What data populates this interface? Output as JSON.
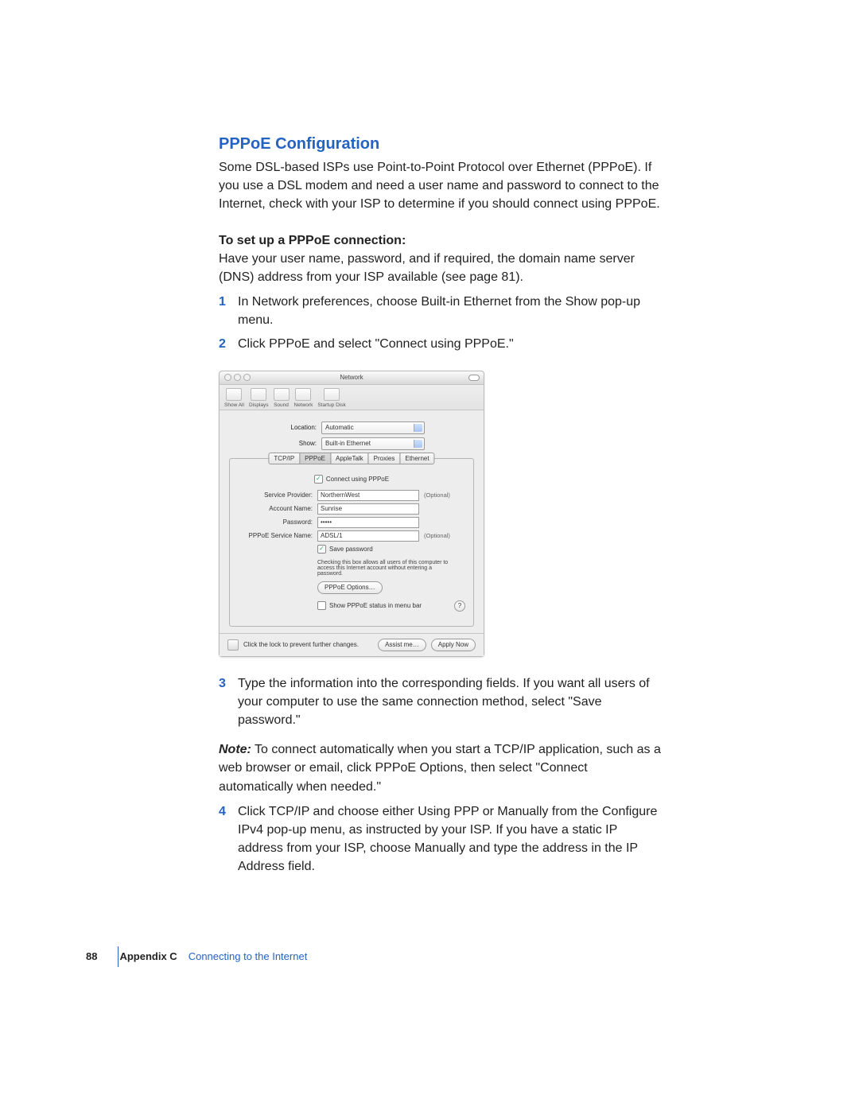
{
  "heading": "PPPoE Configuration",
  "intro": "Some DSL-based ISPs use Point-to-Point Protocol over Ethernet (PPPoE). If you use a DSL modem and need a user name and password to connect to the Internet, check with your ISP to determine if you should connect using PPPoE.",
  "subhead": "To set up a PPPoE connection:",
  "preamble": "Have your user name, password, and if required, the domain name server (DNS) address from your ISP available (see page 81).",
  "steps_a": [
    "In Network preferences, choose Built-in Ethernet from the Show pop-up menu.",
    "Click PPPoE and select \"Connect using PPPoE.\""
  ],
  "steps_b": [
    "Type the information into the corresponding fields. If you want all users of your computer to use the same connection method, select \"Save password.\"",
    "Click TCP/IP and choose either Using PPP or Manually from the Configure IPv4 pop-up menu, as instructed by your ISP. If you have a static IP address from your ISP, choose Manually and type the address in the IP Address field."
  ],
  "note_label": "Note:",
  "note_text": "  To connect automatically when you start a TCP/IP application, such as a web browser or email, click PPPoE Options, then select \"Connect automatically when needed.\"",
  "window": {
    "title": "Network",
    "toolbar": [
      "Show All",
      "Displays",
      "Sound",
      "Network",
      "Startup Disk"
    ],
    "location_label": "Location:",
    "location_value": "Automatic",
    "show_label": "Show:",
    "show_value": "Built-in Ethernet",
    "tabs": [
      "TCP/IP",
      "PPPoE",
      "AppleTalk",
      "Proxies",
      "Ethernet"
    ],
    "connect_label": "Connect using PPPoE",
    "sp_label": "Service Provider:",
    "sp_value": "NorthernWest",
    "sp_optional": "(Optional)",
    "acct_label": "Account Name:",
    "acct_value": "Sunrise",
    "pw_label": "Password:",
    "pw_value": "•••••",
    "svc_label": "PPPoE Service Name:",
    "svc_value": "ADSL/1",
    "svc_optional": "(Optional)",
    "save_label": "Save password",
    "save_hint": "Checking this box allows all users of this computer to access this Internet account without entering a password.",
    "options_btn": "PPPoE Options…",
    "menubar_label": "Show PPPoE status in menu bar",
    "lock_text": "Click the lock to prevent further changes.",
    "assist_btn": "Assist me…",
    "apply_btn": "Apply Now",
    "help": "?"
  },
  "footer": {
    "page_num": "88",
    "appendix": "Appendix C",
    "appendix_title": "Connecting to the Internet"
  }
}
